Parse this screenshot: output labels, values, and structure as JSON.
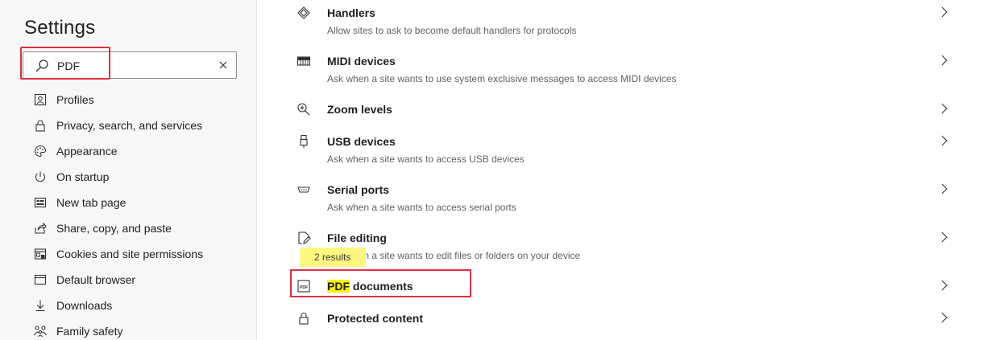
{
  "sidebar": {
    "title": "Settings",
    "search": {
      "value": "PDF",
      "placeholder": ""
    },
    "items": [
      {
        "label": "Profiles",
        "icon": "profile-icon"
      },
      {
        "label": "Privacy, search, and services",
        "icon": "lock-icon"
      },
      {
        "label": "Appearance",
        "icon": "palette-icon"
      },
      {
        "label": "On startup",
        "icon": "power-icon"
      },
      {
        "label": "New tab page",
        "icon": "new-tab-icon"
      },
      {
        "label": "Share, copy, and paste",
        "icon": "share-icon"
      },
      {
        "label": "Cookies and site permissions",
        "icon": "permissions-icon"
      },
      {
        "label": "Default browser",
        "icon": "browser-icon"
      },
      {
        "label": "Downloads",
        "icon": "download-icon"
      },
      {
        "label": "Family safety",
        "icon": "family-icon"
      }
    ]
  },
  "main": {
    "rows": [
      {
        "title": "Handlers",
        "desc": "Allow sites to ask to become default handlers for protocols",
        "icon": "handlers-icon"
      },
      {
        "title": "MIDI devices",
        "desc": "Ask when a site wants to use system exclusive messages to access MIDI devices",
        "icon": "midi-icon"
      },
      {
        "title": "Zoom levels",
        "desc": "",
        "icon": "zoom-icon"
      },
      {
        "title": "USB devices",
        "desc": "Ask when a site wants to access USB devices",
        "icon": "usb-icon"
      },
      {
        "title": "Serial ports",
        "desc": "Ask when a site wants to access serial ports",
        "icon": "serial-port-icon"
      },
      {
        "title": "File editing",
        "desc": "Ask when a site wants to edit files or folders on your device",
        "icon": "file-edit-icon"
      },
      {
        "title_highlight": "PDF",
        "title_rest": " documents",
        "desc": "",
        "icon": "pdf-icon"
      },
      {
        "title": "Protected content",
        "desc": "",
        "icon": "lock-icon"
      }
    ],
    "tooltip": "2 results"
  },
  "colors": {
    "highlight_border": "#e0303f",
    "search_match": "#fff200",
    "tooltip_bg": "#fff87a"
  }
}
